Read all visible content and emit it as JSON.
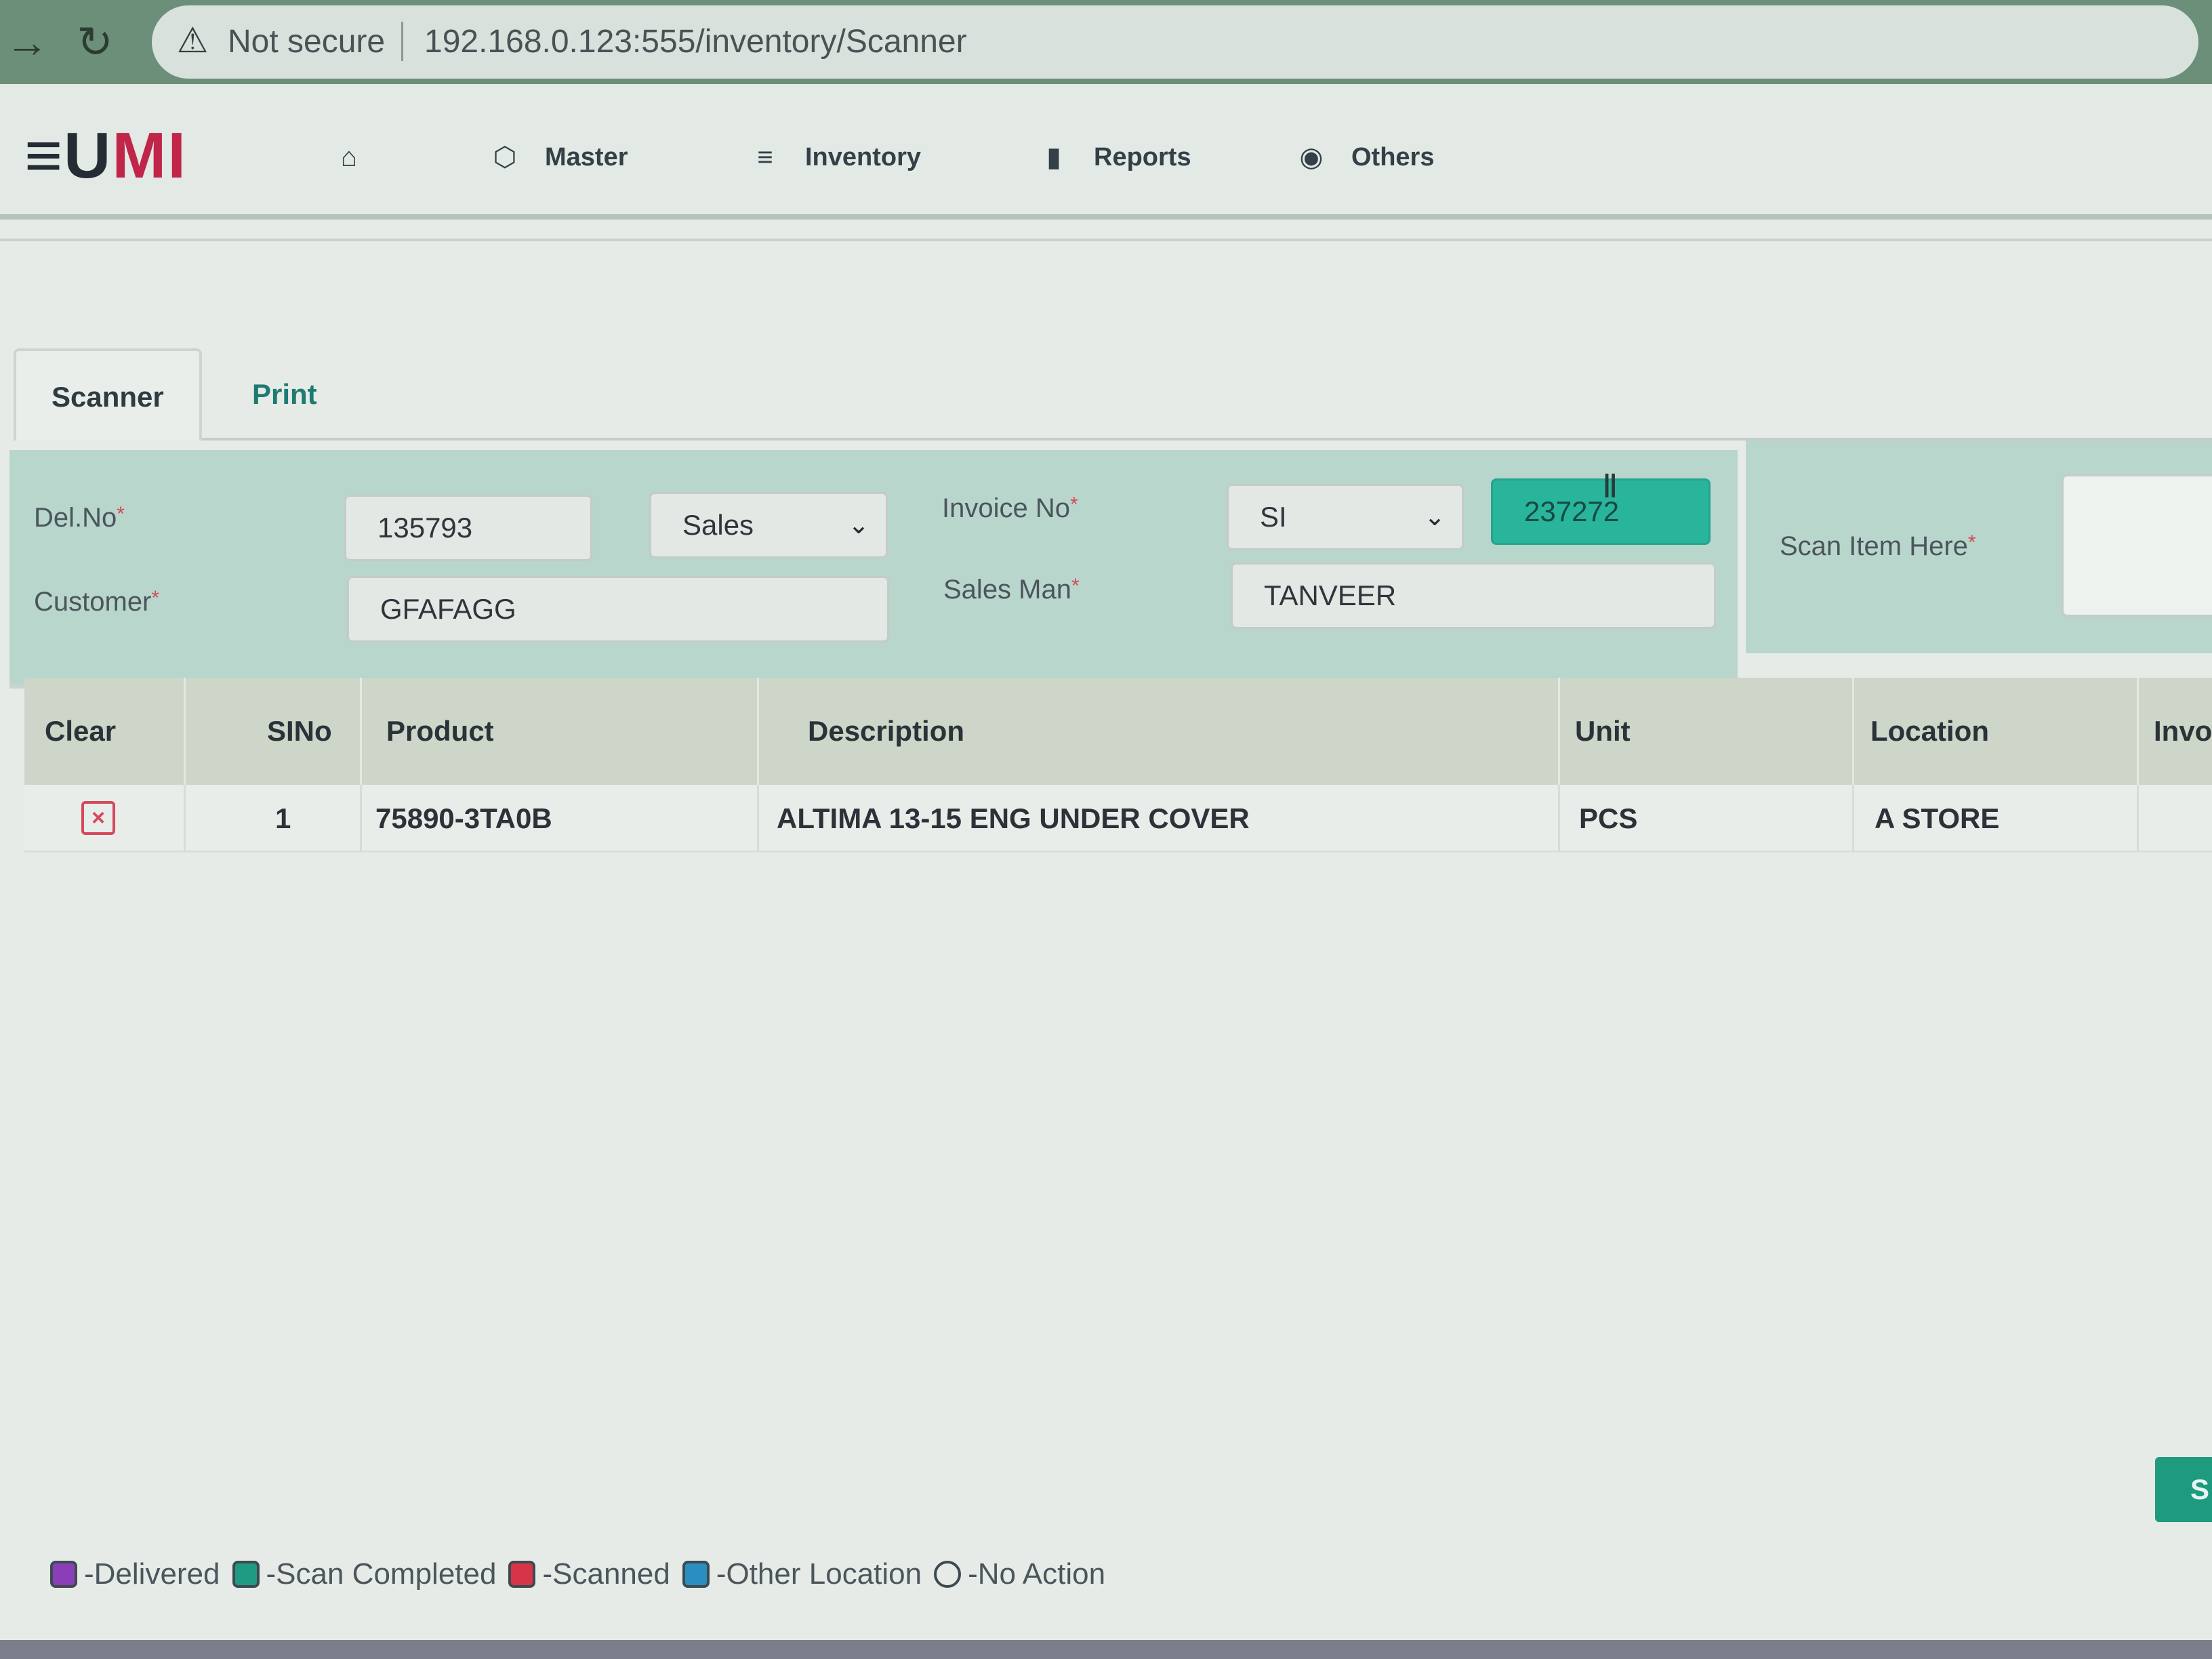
{
  "browser": {
    "security_label": "Not secure",
    "url": "192.168.0.123:555/inventory/Scanner"
  },
  "app": {
    "logo_prefix": "≡U",
    "logo_suffix": "MI"
  },
  "nav": {
    "items": [
      {
        "label": "Master"
      },
      {
        "label": "Inventory"
      },
      {
        "label": "Reports"
      },
      {
        "label": "Others"
      }
    ]
  },
  "tabs": [
    {
      "label": "Scanner"
    },
    {
      "label": "Print"
    }
  ],
  "form": {
    "delno_label": "Del.No",
    "delno_value": "135793",
    "type_value": "Sales",
    "invoice_label": "Invoice No",
    "invoice_prefix": "SI",
    "invoice_number": "237272",
    "customer_label": "Customer",
    "customer_value": "GFAFAGG",
    "salesman_label": "Sales Man",
    "salesman_value": "TANVEER",
    "scan_label": "Scan Item Here",
    "required_mark": "*"
  },
  "table": {
    "columns": [
      "Clear",
      "SINo",
      "Product",
      "Description",
      "Unit",
      "Location",
      "Invoic"
    ],
    "rows": [
      {
        "sino": "1",
        "product": "75890-3TA0B",
        "description": "ALTIMA 13-15 ENG UNDER COVER",
        "unit": "PCS",
        "location": "A STORE",
        "invoice": ""
      }
    ]
  },
  "actions": {
    "save_label": "S"
  },
  "legend": [
    {
      "label": "-Delivered",
      "color": "#8a3fb8"
    },
    {
      "label": "-Scan Completed",
      "color": "#1f9b83"
    },
    {
      "label": "-Scanned",
      "color": "#d7344a"
    },
    {
      "label": "-Other Location",
      "color": "#2a8fc0"
    },
    {
      "label": "-No Action",
      "color": "transparent"
    }
  ],
  "icons": {
    "back": "arrow-right-icon",
    "reload": "reload-icon",
    "warning": "warning-icon",
    "home": "home-icon",
    "master": "cube-icon",
    "inventory": "layers-icon",
    "reports": "bar-chart-icon",
    "others": "globe-icon",
    "clear_row": "close-square-icon"
  },
  "colors": {
    "accent": "#1e9a7f",
    "invoice_field": "#28b59b",
    "danger": "#d6485a",
    "brand_red": "#c2254a"
  }
}
